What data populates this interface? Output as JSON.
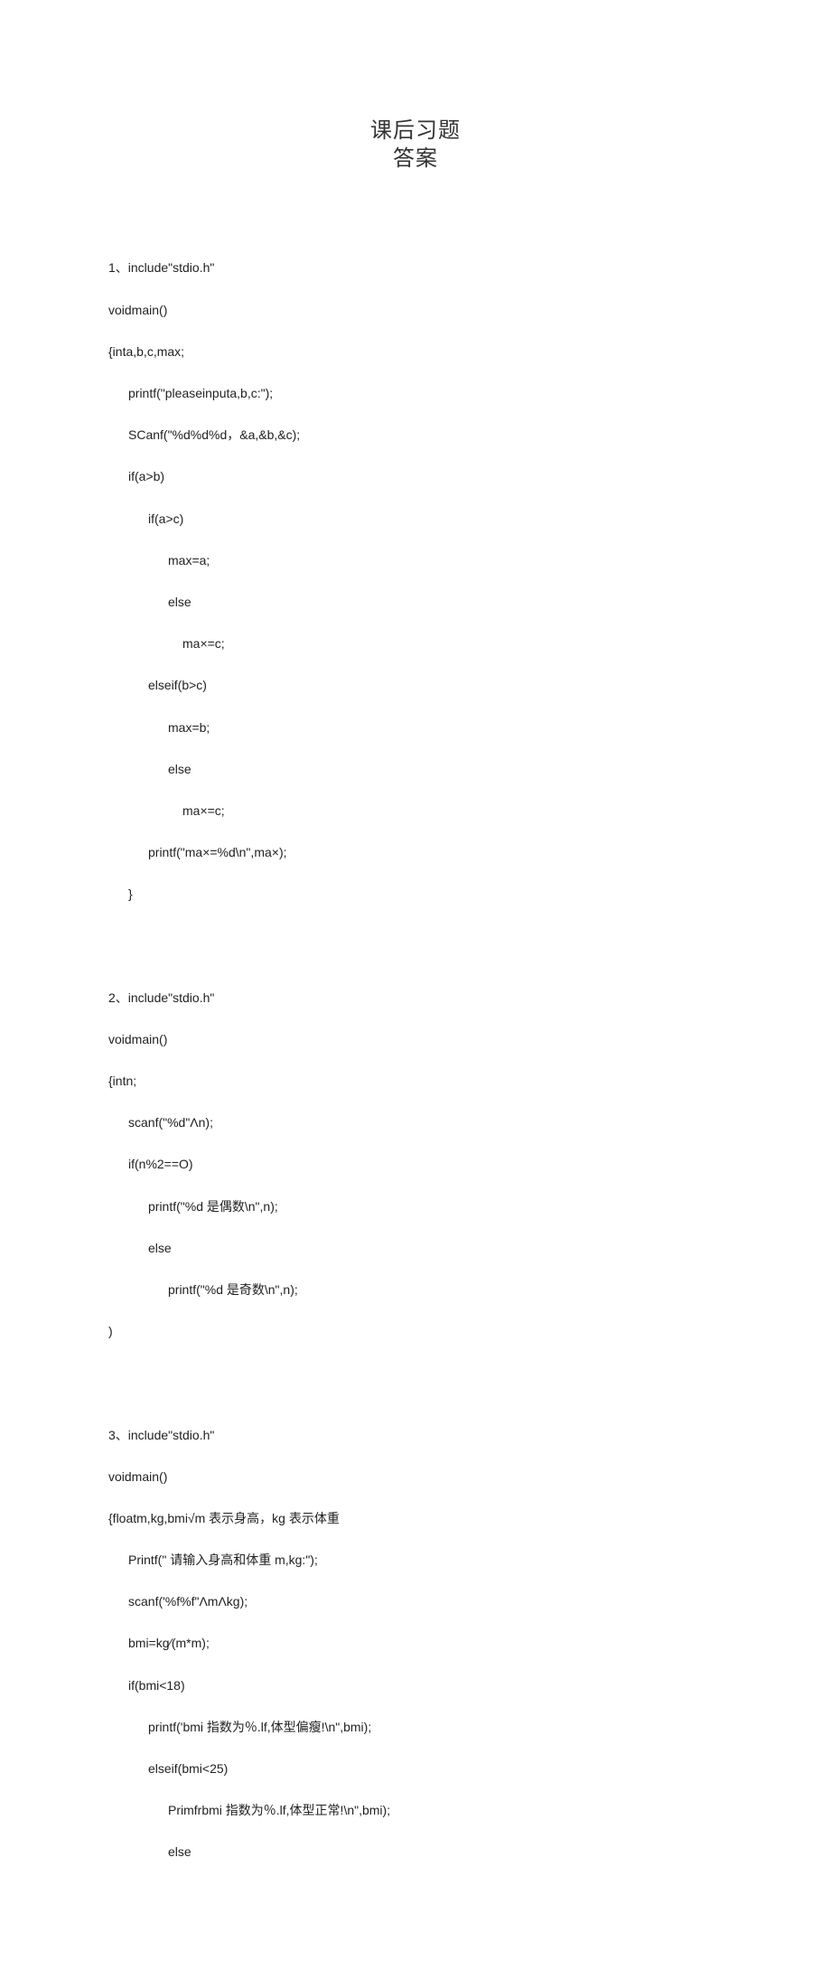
{
  "title_line1": "课后习题",
  "title_line2": "答案",
  "block1": {
    "l0": "1、include\"stdio.h\"",
    "l1": "voidmain()",
    "l2": "{inta,b,c,max;",
    "l3": "printf(\"pleaseinputa,b,c:\");",
    "l4": "SCanf(\"%d%d%d，&a,&b,&c);",
    "l5": "if(a>b)",
    "l6": "if(a>c)",
    "l7": "max=a;",
    "l8": "else",
    "l9": "ma×=c;",
    "l10": "elseif(b>c)",
    "l11": "max=b;",
    "l12": "else",
    "l13": "ma×=c;",
    "l14": "printf(\"ma×=%d\\n\",ma×);",
    "l15": "}"
  },
  "block2": {
    "l0": "2、include\"stdio.h\"",
    "l1": "voidmain()",
    "l2": "{intn;",
    "l3": "scanf(\"%d\"Λn);",
    "l4": "if(n%2==O)",
    "l5": "printf(\"%d 是偶数\\n\",n);",
    "l6": "else",
    "l7": "printf(\"%d 是奇数\\n\",n);",
    "l8": ")"
  },
  "block3": {
    "l0": "3、include\"stdio.h\"",
    "l1": "voidmain()",
    "l2": "{floatm,kg,bmi√m 表示身高，kg 表示体重",
    "l3": "Printf(\" 请输入身高和体重 m,kg:\");",
    "l4": "scanf('%f%f\"ΛmΛkg);",
    "l5": "bmi=kg∕(m*m);",
    "l6": "if(bmi<18)",
    "l7": "printf('bmi 指数为％.lf,体型偏瘦!\\n\",bmi);",
    "l8": "elseif(bmi<25)",
    "l9": "Primfrbmi 指数为％.lf,体型正常!\\n\",bmi);",
    "l10": "else"
  }
}
